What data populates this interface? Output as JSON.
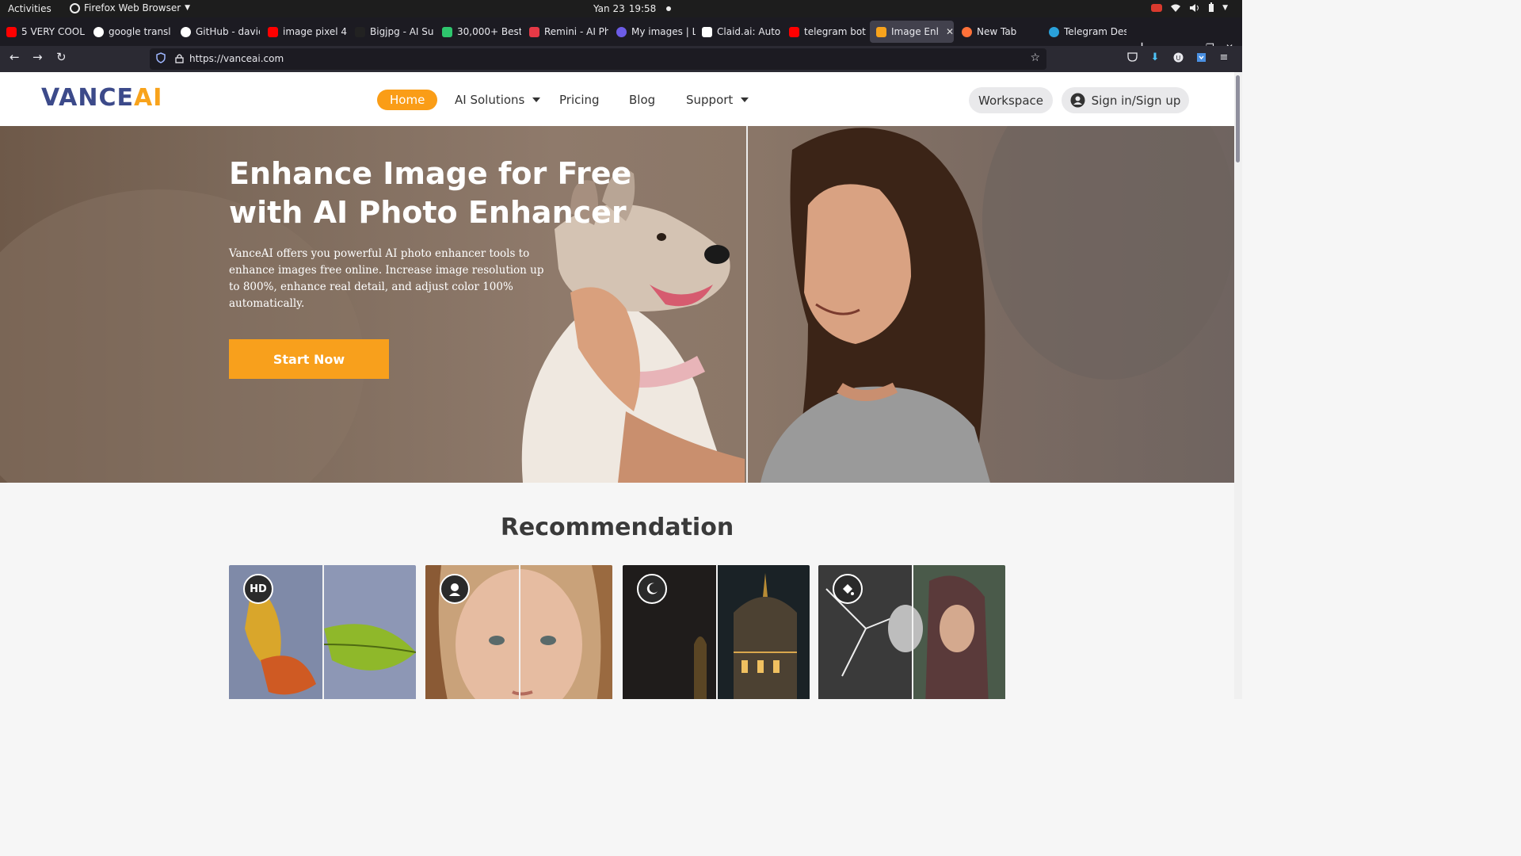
{
  "system": {
    "activities": "Activities",
    "app_name": "Firefox Web Browser",
    "clock": {
      "date": "Yan 23",
      "time": "19:58"
    }
  },
  "tabs": [
    {
      "label": "5 VERY COOL",
      "favicon": "youtube-icon",
      "color": "#ff0000"
    },
    {
      "label": "google transl",
      "favicon": "google-icon",
      "color": "#ffffff"
    },
    {
      "label": "GitHub - davic",
      "favicon": "github-icon",
      "color": "#ffffff"
    },
    {
      "label": "image pixel 4",
      "favicon": "youtube-icon",
      "color": "#ff0000"
    },
    {
      "label": "Bigjpg - AI Su",
      "favicon": "bigjpg-icon",
      "color": "#222222"
    },
    {
      "label": "30,000+ Best",
      "favicon": "pixabay-icon",
      "color": "#2ec66d"
    },
    {
      "label": "Remini - AI Ph",
      "favicon": "remini-icon",
      "color": "#e63946"
    },
    {
      "label": "My images | L",
      "favicon": "letsenhance-icon",
      "color": "#6c5ce7"
    },
    {
      "label": "Claid.ai: Auto",
      "favicon": "claid-icon",
      "color": "#ffffff"
    },
    {
      "label": "telegram bot",
      "favicon": "youtube-icon",
      "color": "#ff0000"
    },
    {
      "label": "Image Enha",
      "favicon": "vanceai-icon",
      "color": "#f8a31c",
      "active": true
    },
    {
      "label": "New Tab",
      "favicon": "firefox-icon",
      "color": "#ff7139"
    },
    {
      "label": "Telegram Des",
      "favicon": "telegram-icon",
      "color": "#2aa1da"
    }
  ],
  "navbar": {
    "url": "https://vanceai.com"
  },
  "site": {
    "logo": {
      "part1": "VANCE",
      "part2": "AI"
    },
    "menu": {
      "home": "Home",
      "ai_solutions": "AI Solutions",
      "pricing": "Pricing",
      "blog": "Blog",
      "support": "Support"
    },
    "workspace": "Workspace",
    "signin": "Sign in/Sign up",
    "accent": "#fa9d17",
    "brand_blue": "#3c4a8a"
  },
  "hero": {
    "title": "Enhance Image for Free with AI Photo Enhancer",
    "description": "VanceAI offers you powerful AI photo enhancer tools to enhance images free online. Increase image resolution up to 800%, enhance real detail, and adjust color 100% automatically.",
    "cta": "Start Now"
  },
  "recommendation": {
    "title": "Recommendation",
    "cards": [
      {
        "icon": "hd-icon",
        "badge": "HD"
      },
      {
        "icon": "portrait-icon"
      },
      {
        "icon": "night-moon-icon"
      },
      {
        "icon": "colorize-icon"
      }
    ]
  }
}
